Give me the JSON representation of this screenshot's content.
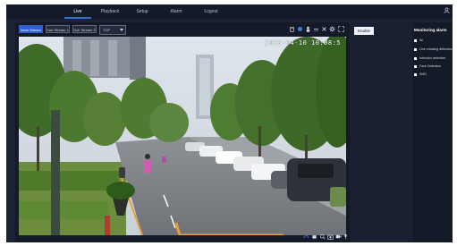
{
  "nav": {
    "tabs": [
      {
        "label": "Live",
        "active": true
      },
      {
        "label": "Playback",
        "active": false
      },
      {
        "label": "Setup",
        "active": false
      },
      {
        "label": "Alarm",
        "active": false
      },
      {
        "label": "Logout",
        "active": false
      }
    ]
  },
  "toolbar": {
    "main_stream": "Main Stream",
    "sub_stream_1": "Sub Stream 1",
    "sub_stream_2": "Sub Stream 2",
    "protocol_value": "TCP"
  },
  "video": {
    "osd_text": "2023-04-10 10:08:5"
  },
  "side": {
    "enable_label": "Enable"
  },
  "monitoring": {
    "title": "Monitoring alarm",
    "items": [
      {
        "label": "All"
      },
      {
        "label": "Line crossing detection"
      },
      {
        "label": "Intrusion detection"
      },
      {
        "label": "Face Detection"
      },
      {
        "label": "SMD"
      }
    ]
  },
  "colors": {
    "accent": "#2f6fd6",
    "background": "#1c2233"
  }
}
